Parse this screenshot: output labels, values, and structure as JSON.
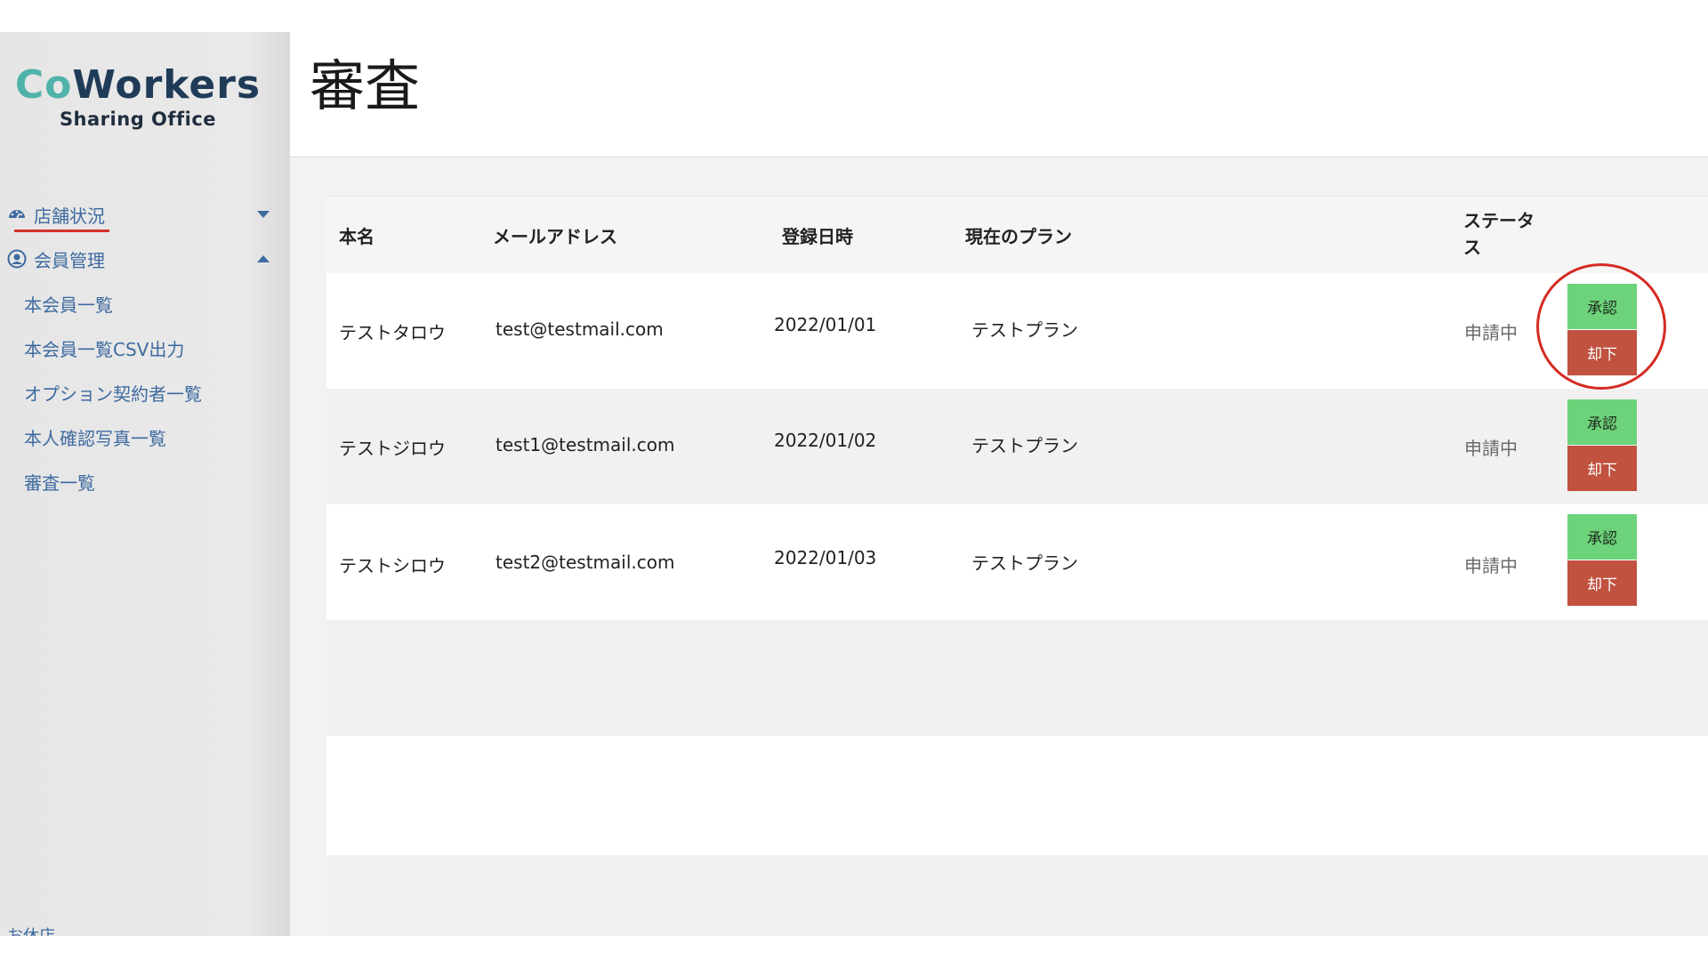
{
  "brand": {
    "logo_co": "Co",
    "logo_workers": "Workers",
    "logo_sub": "Sharing Office"
  },
  "sidebar": {
    "groups": [
      {
        "label": "店舗状況",
        "icon": "dashboard-gauge-icon",
        "expanded": false
      },
      {
        "label": "会員管理",
        "icon": "user-circle-icon",
        "expanded": true
      }
    ],
    "member_items": [
      {
        "label": "本会員一覧"
      },
      {
        "label": "本会員一覧CSV出力"
      },
      {
        "label": "オプション契約者一覧"
      },
      {
        "label": "本人確認写真一覧"
      },
      {
        "label": "審査一覧",
        "active": true
      }
    ],
    "bottom_partial": "お休店"
  },
  "header": {
    "title": "審査"
  },
  "table": {
    "columns": {
      "name": "本名",
      "email": "メールアドレス",
      "registered": "登録日時",
      "plan": "現在のプラン",
      "status_line1": "ステータ",
      "status_line2": "ス"
    },
    "approve_label": "承認",
    "reject_label": "却下",
    "rows": [
      {
        "name": "テストタロウ",
        "email": "test@testmail.com",
        "registered": "2022/01/01",
        "plan": "テストプラン",
        "status": "申請中"
      },
      {
        "name": "テストジロウ",
        "email": "test1@testmail.com",
        "registered": "2022/01/02",
        "plan": "テストプラン",
        "status": "申請中"
      },
      {
        "name": "テストシロウ",
        "email": "test2@testmail.com",
        "registered": "2022/01/03",
        "plan": "テストプラン",
        "status": "申請中"
      }
    ]
  },
  "colors": {
    "accent_link": "#3e6aa0",
    "approve": "#6dd37a",
    "reject": "#c0523f",
    "annotation_red": "#d52b24",
    "logo_teal": "#4fb3a9",
    "logo_navy": "#1f3b57"
  }
}
